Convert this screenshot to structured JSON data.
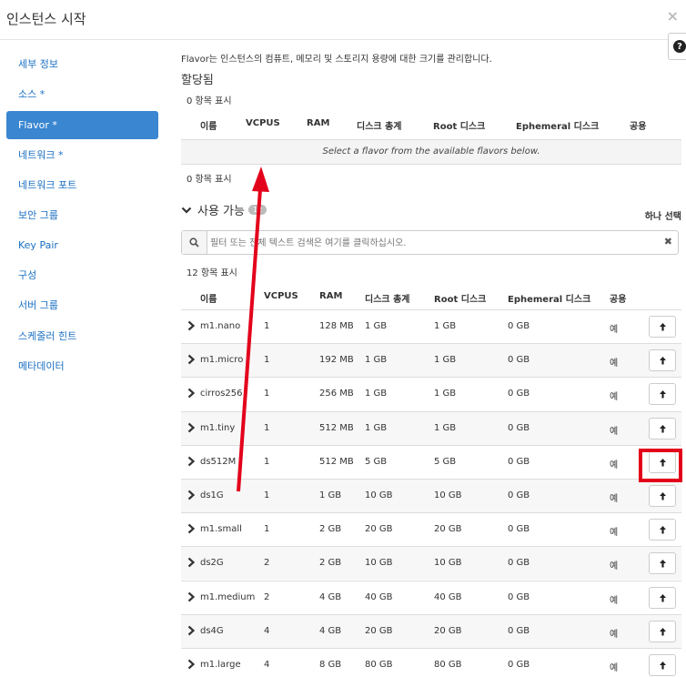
{
  "modal": {
    "title": "인스턴스 시작",
    "close_icon": "×",
    "help_icon": "?"
  },
  "sidebar": {
    "items": [
      {
        "label": "세부 정보",
        "required": ""
      },
      {
        "label": "소스",
        "required": "*"
      },
      {
        "label": "Flavor",
        "required": "*",
        "active": true
      },
      {
        "label": "네트워크",
        "required": "*"
      },
      {
        "label": "네트워크 포트",
        "required": ""
      },
      {
        "label": "보안 그룹",
        "required": ""
      },
      {
        "label": "Key Pair",
        "required": ""
      },
      {
        "label": "구성",
        "required": ""
      },
      {
        "label": "서버 그룹",
        "required": ""
      },
      {
        "label": "스케줄러 힌트",
        "required": ""
      },
      {
        "label": "메타데이터",
        "required": ""
      }
    ]
  },
  "main": {
    "description": "Flavor는 인스턴스의 컴퓨트, 메모리 및 스토리지 용량에 대한 크기를 관리합니다.",
    "allocated": {
      "title": "할당됨",
      "count_top": "0 항목 표시",
      "count_bottom": "0 항목 표시",
      "columns": [
        "이름",
        "VCPUS",
        "RAM",
        "디스크 총계",
        "Root 디스크",
        "Ephemeral 디스크",
        "공용"
      ],
      "empty_message": "Select a flavor from the available flavors below."
    },
    "available": {
      "title": "사용 가능",
      "badge": "12",
      "select_one": "하나 선택",
      "search_placeholder": "필터 또는 전체 텍스트 검색은 여기를 클릭하십시오.",
      "count": "12 항목 표시",
      "columns": [
        "이름",
        "VCPUS",
        "RAM",
        "디스크 총계",
        "Root 디스크",
        "Ephemeral 디스크",
        "공용"
      ],
      "rows": [
        {
          "name": "m1.nano",
          "vcpus": "1",
          "ram": "128 MB",
          "disk_total": "1 GB",
          "root_disk": "1 GB",
          "ephemeral": "0 GB",
          "public": "예"
        },
        {
          "name": "m1.micro",
          "vcpus": "1",
          "ram": "192 MB",
          "disk_total": "1 GB",
          "root_disk": "1 GB",
          "ephemeral": "0 GB",
          "public": "예"
        },
        {
          "name": "cirros256",
          "vcpus": "1",
          "ram": "256 MB",
          "disk_total": "1 GB",
          "root_disk": "1 GB",
          "ephemeral": "0 GB",
          "public": "예"
        },
        {
          "name": "m1.tiny",
          "vcpus": "1",
          "ram": "512 MB",
          "disk_total": "1 GB",
          "root_disk": "1 GB",
          "ephemeral": "0 GB",
          "public": "예"
        },
        {
          "name": "ds512M",
          "vcpus": "1",
          "ram": "512 MB",
          "disk_total": "5 GB",
          "root_disk": "5 GB",
          "ephemeral": "0 GB",
          "public": "예"
        },
        {
          "name": "ds1G",
          "vcpus": "1",
          "ram": "1 GB",
          "disk_total": "10 GB",
          "root_disk": "10 GB",
          "ephemeral": "0 GB",
          "public": "예"
        },
        {
          "name": "m1.small",
          "vcpus": "1",
          "ram": "2 GB",
          "disk_total": "20 GB",
          "root_disk": "20 GB",
          "ephemeral": "0 GB",
          "public": "예"
        },
        {
          "name": "ds2G",
          "vcpus": "2",
          "ram": "2 GB",
          "disk_total": "10 GB",
          "root_disk": "10 GB",
          "ephemeral": "0 GB",
          "public": "예"
        },
        {
          "name": "m1.medium",
          "vcpus": "2",
          "ram": "4 GB",
          "disk_total": "40 GB",
          "root_disk": "40 GB",
          "ephemeral": "0 GB",
          "public": "예"
        },
        {
          "name": "ds4G",
          "vcpus": "4",
          "ram": "4 GB",
          "disk_total": "20 GB",
          "root_disk": "20 GB",
          "ephemeral": "0 GB",
          "public": "예"
        },
        {
          "name": "m1.large",
          "vcpus": "4",
          "ram": "8 GB",
          "disk_total": "80 GB",
          "root_disk": "80 GB",
          "ephemeral": "0 GB",
          "public": "예"
        }
      ]
    }
  },
  "annotations": {
    "arrow_color": "#e3001b",
    "highlight_color": "#e3001b"
  },
  "icons": {
    "search": "search-icon",
    "allocate": "arrow-up-icon",
    "expand": "chevron-right-icon",
    "section": "chevron-down-icon"
  }
}
